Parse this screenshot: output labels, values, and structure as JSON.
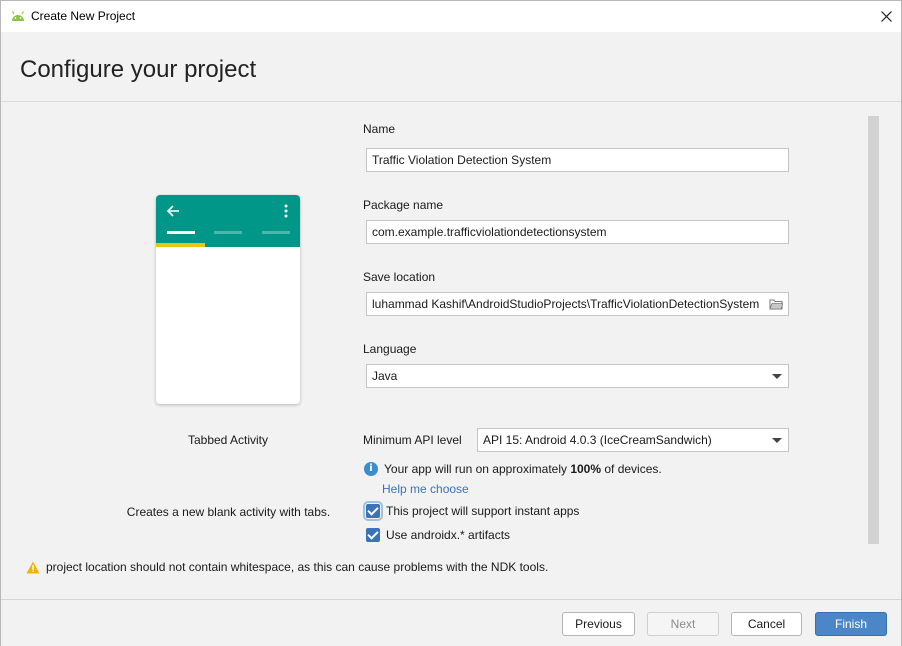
{
  "window": {
    "title": "Create New Project"
  },
  "header": {
    "title": "Configure your project"
  },
  "template": {
    "name": "Tabbed Activity",
    "description": "Creates a new blank activity with tabs."
  },
  "form": {
    "name": {
      "label": "Name",
      "value": "Traffic Violation Detection System"
    },
    "package": {
      "label": "Package name",
      "value": "com.example.trafficviolationdetectionsystem"
    },
    "location": {
      "label": "Save location",
      "value": "luhammad Kashif\\AndroidStudioProjects\\TrafficViolationDetectionSystem"
    },
    "language": {
      "label": "Language",
      "value": "Java"
    },
    "min_api": {
      "label": "Minimum API level",
      "value": "API 15: Android 4.0.3 (IceCreamSandwich)"
    },
    "info": {
      "prefix": "Your app will run on approximately ",
      "percent": "100%",
      "suffix": " of devices."
    },
    "help_link": "Help me choose",
    "instant_apps": {
      "label": "This project will support instant apps",
      "checked": true
    },
    "androidx": {
      "label": "Use androidx.* artifacts",
      "checked": true
    }
  },
  "warning": "project location should not contain whitespace, as this can cause problems with the NDK tools.",
  "buttons": {
    "previous": "Previous",
    "next": "Next",
    "cancel": "Cancel",
    "finish": "Finish"
  },
  "colors": {
    "preview_bar": "#009688",
    "tab_indicator": "#e6c619",
    "primary_button": "#4a86c8",
    "link": "#3a73b8"
  }
}
